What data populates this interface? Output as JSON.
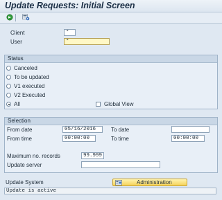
{
  "window": {
    "title": "Update Requests: Initial Screen"
  },
  "toolbar": {
    "execute_icon": "execute-icon",
    "variant_icon": "get-variant-icon"
  },
  "header_fields": {
    "client_label": "Client",
    "client_value": "*",
    "user_label": "User",
    "user_value": "*"
  },
  "status_group": {
    "title": "Status",
    "options": [
      "Canceled",
      "To be updated",
      "V1 executed",
      "V2 Executed",
      "All"
    ],
    "selected": "All",
    "global_view_label": "Global View",
    "global_view_checked": false
  },
  "selection_group": {
    "title": "Selection",
    "from_date_label": "From date",
    "from_date_value": "05/16/2016",
    "to_date_label": "To date",
    "to_date_value": "",
    "from_time_label": "From time",
    "from_time_value": "00:00:00",
    "to_time_label": "To time",
    "to_time_value": "00:00:00",
    "max_records_label": "Maximum no. records",
    "max_records_value": "99.999",
    "update_server_label": "Update server",
    "update_server_value": ""
  },
  "update_system": {
    "label": "Update System",
    "admin_button_label": "Administration",
    "status_text": "Update is active"
  },
  "colors": {
    "required_field": "#fff8c6",
    "button": "#f6d35a",
    "group_header": "#c9d7e6"
  }
}
